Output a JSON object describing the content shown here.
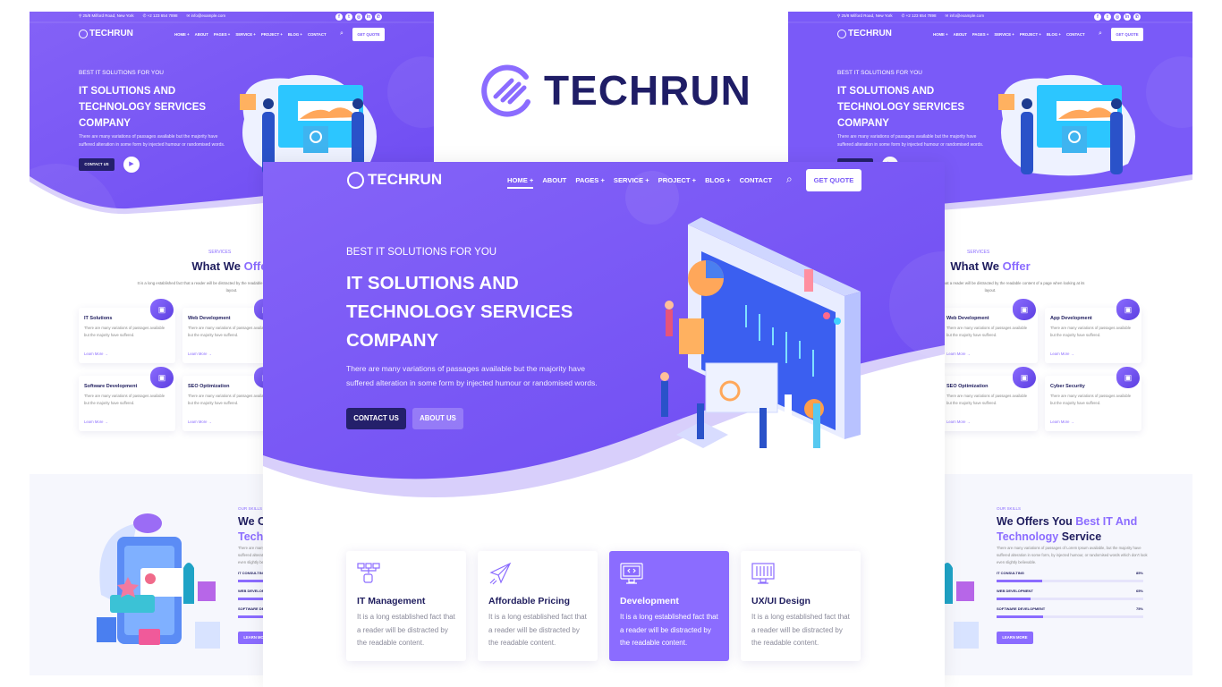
{
  "brand": {
    "name": "TECHRUN",
    "accent": "#8b6cff",
    "navy": "#1f1d66",
    "hero": "#7a5af8"
  },
  "topbar": {
    "address": "25/8 Milford Road, New York",
    "phone": "+2 123 654 7898",
    "email": "info@example.com",
    "socials": [
      "facebook-icon",
      "twitter-icon",
      "instagram-icon",
      "linkedin-icon",
      "whatsapp-icon"
    ]
  },
  "nav": {
    "items": [
      "HOME +",
      "ABOUT",
      "PAGES +",
      "SERVICE +",
      "PROJECT +",
      "BLOG +",
      "CONTACT"
    ],
    "quote": "GET QUOTE"
  },
  "hero": {
    "subtitle": "BEST IT SOLUTIONS FOR YOU",
    "title": "IT SOLUTIONS AND TECHNOLOGY SERVICES COMPANY",
    "description": "There are many variations of passages available but the majority have suffered alteration in some form by injected humour or randomised words.",
    "contact": "CONTACT US",
    "about": "ABOUT US"
  },
  "services": {
    "tag": "SERVICES",
    "title_a": "What We ",
    "title_b": "Offer",
    "description": "It is a long established fact that a reader will be distracted by the readable content of a page when looking at its layout.",
    "card_text": "There are many variations of passages available but the majority have suffered.",
    "link": "Learn More →",
    "items": [
      "IT Solutions",
      "Web Development",
      "App Development",
      "Software Development",
      "SEO Optimization",
      "Cyber Security"
    ]
  },
  "skills": {
    "tag": "OUR SKILLS",
    "title_a": "We Offers You ",
    "title_b": "Best IT And Technology",
    "title_c": " Service",
    "description": "There are many variations of passages of Lorem Ipsum available, but the majority have suffered alteration in some form, by injected humour, or randomised words which don't look even slightly believable.",
    "bars": [
      {
        "label": "IT CONSULTING",
        "value": "85%",
        "fill": 0.31
      },
      {
        "label": "WEB DEVELOPMENT",
        "value": "65%",
        "fill": 0.23
      },
      {
        "label": "SOFTWARE DEVELOPMENT",
        "value": "75%",
        "fill": 0.32
      }
    ],
    "button": "LEARN MORE"
  },
  "features": [
    {
      "title": "IT Management",
      "text": "It is a long established fact that a reader will be distracted by the readable content.",
      "icon": "network-icon"
    },
    {
      "title": "Affordable Pricing",
      "text": "It is a long established fact that a reader will be distracted by the readable content.",
      "icon": "paper-plane-icon"
    },
    {
      "title": "Development",
      "text": "It is a long established fact that a reader will be distracted by the readable content.",
      "icon": "code-monitor-icon",
      "active": true
    },
    {
      "title": "UX/UI Design",
      "text": "It is a long established fact that a reader will be distracted by the readable content.",
      "icon": "design-monitor-icon"
    }
  ]
}
